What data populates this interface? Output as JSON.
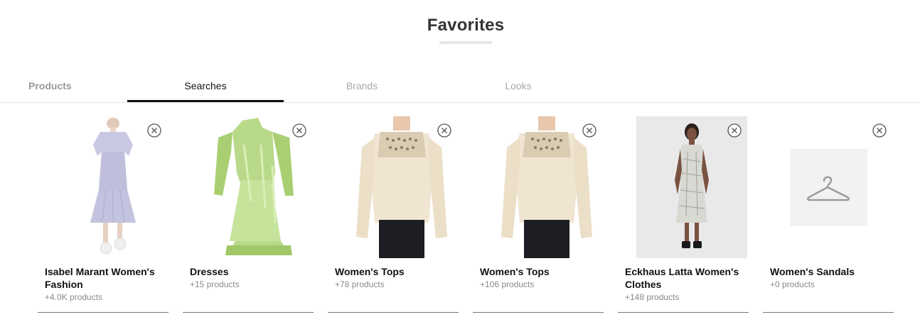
{
  "header": {
    "title": "Favorites"
  },
  "tabs": [
    {
      "label": "Products"
    },
    {
      "label": "Searches"
    },
    {
      "label": "Brands"
    },
    {
      "label": "Looks"
    }
  ],
  "cards": [
    {
      "name": "Isabel Marant Women's Fashion",
      "count": "+4.0K products",
      "image": "lavender-dress-photo"
    },
    {
      "name": "Dresses",
      "count": "+15 products",
      "image": "green-dress-photo"
    },
    {
      "name": "Women's Tops",
      "count": "+78 products",
      "image": "cream-blouse-photo"
    },
    {
      "name": "Women's Tops",
      "count": "+106 products",
      "image": "cream-blouse-photo"
    },
    {
      "name": "Eckhaus Latta Women's Clothes",
      "count": "+148 products",
      "image": "model-print-dress-photo"
    },
    {
      "name": "Women's Sandals",
      "count": "+0 products",
      "image": "hanger-placeholder-icon"
    }
  ],
  "icons": {
    "remove": "close-circle-icon"
  }
}
